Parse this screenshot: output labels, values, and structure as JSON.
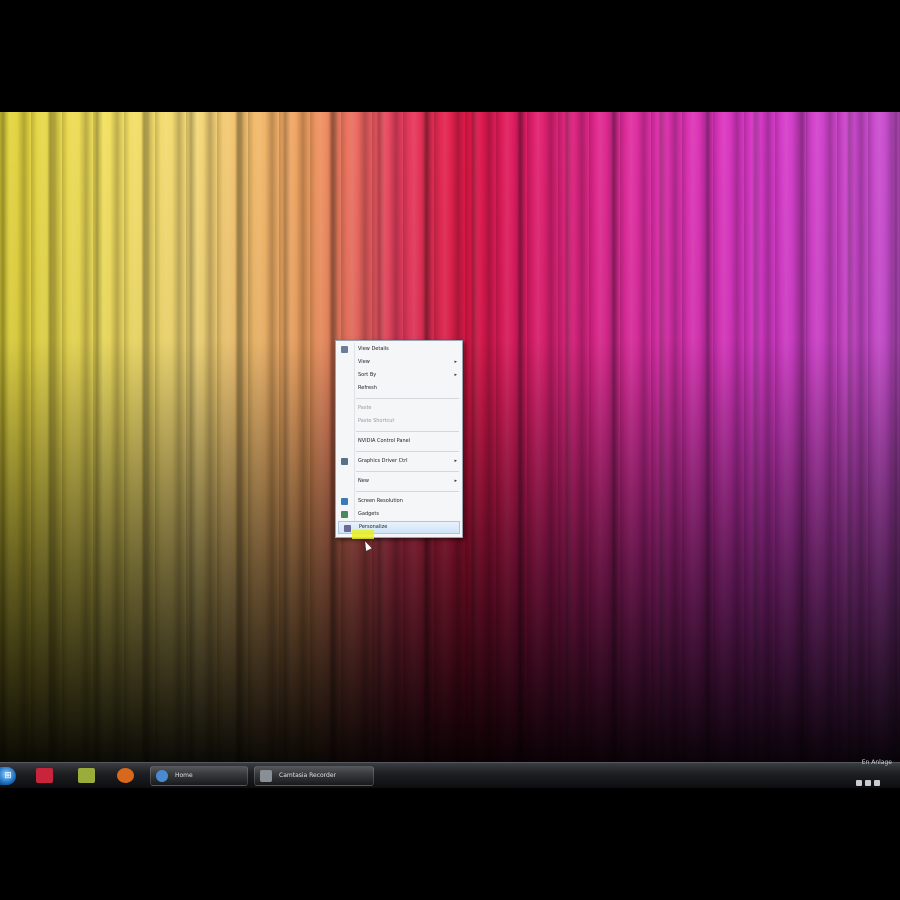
{
  "context_menu": {
    "items": [
      {
        "label": "View Details",
        "icon": "view-icon",
        "color": "#6a7d9a",
        "disabled": false,
        "submenu": false
      },
      {
        "label": "View",
        "icon": "",
        "color": "",
        "disabled": false,
        "submenu": true
      },
      {
        "label": "Sort By",
        "icon": "",
        "color": "",
        "disabled": false,
        "submenu": true
      },
      {
        "label": "Refresh",
        "icon": "",
        "color": "",
        "disabled": false,
        "submenu": false
      },
      {
        "sep": true
      },
      {
        "label": "Paste",
        "icon": "",
        "color": "",
        "disabled": true,
        "submenu": false
      },
      {
        "label": "Paste Shortcut",
        "icon": "",
        "color": "",
        "disabled": true,
        "submenu": false
      },
      {
        "sep": true
      },
      {
        "label": "NVIDIA Control Panel",
        "icon": "",
        "color": "",
        "disabled": false,
        "submenu": false
      },
      {
        "sep": true
      },
      {
        "label": "Graphics Driver Ctrl",
        "icon": "display-icon",
        "color": "#5a6f8a",
        "disabled": false,
        "submenu": true
      },
      {
        "sep": true
      },
      {
        "label": "New",
        "icon": "",
        "color": "",
        "disabled": false,
        "submenu": true
      },
      {
        "sep": true
      },
      {
        "label": "Screen Resolution",
        "icon": "screen-resolution-icon",
        "color": "#3a7ab8",
        "disabled": false,
        "submenu": false
      },
      {
        "label": "Gadgets",
        "icon": "gadgets-icon",
        "color": "#4a8a5a",
        "disabled": false,
        "submenu": false
      },
      {
        "label": "Personalize",
        "icon": "personalize-icon",
        "color": "#6a6a9a",
        "disabled": false,
        "submenu": false,
        "highlight": true
      }
    ]
  },
  "taskbar": {
    "start_icon": "start-orb-icon",
    "start_glyph": "⊞",
    "quick_launch": [
      {
        "name": "media-player-icon",
        "color": "#c8243c"
      },
      {
        "name": "folder-icon",
        "color": "#9aac3a"
      },
      {
        "name": "firefox-icon",
        "color": "#d8681c"
      }
    ],
    "tasks": [
      {
        "label": "Home",
        "icon_color": "#4a8ad0"
      },
      {
        "label": "Camtasia Recorder",
        "icon_color": "#8a8f96"
      }
    ],
    "clock_text": "En Anlage"
  }
}
